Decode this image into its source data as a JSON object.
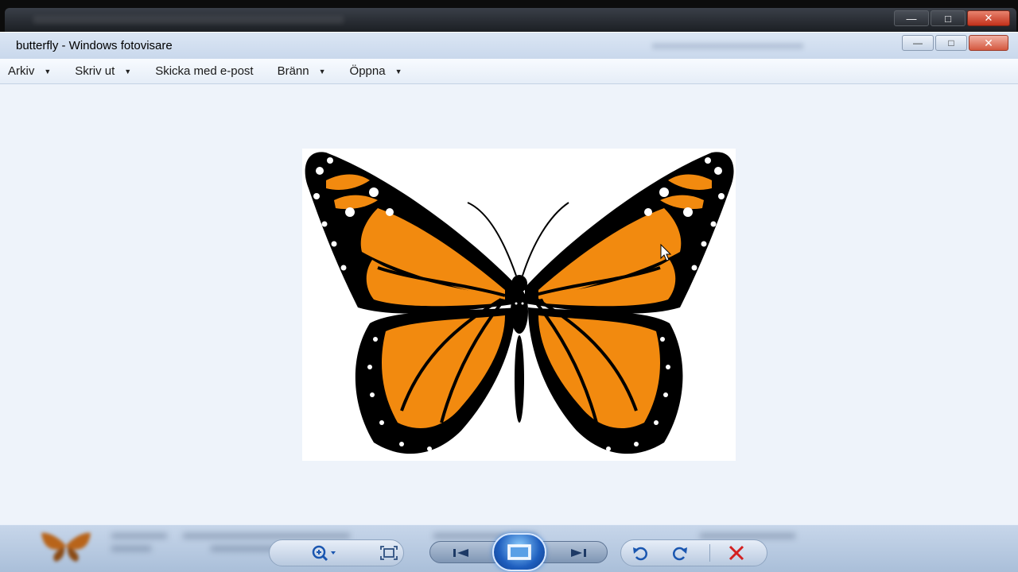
{
  "window": {
    "title": "butterfly - Windows fotovisare"
  },
  "menu": {
    "items": [
      {
        "label": "Arkiv",
        "has_dropdown": true
      },
      {
        "label": "Skriv ut",
        "has_dropdown": true
      },
      {
        "label": "Skicka med e-post",
        "has_dropdown": false
      },
      {
        "label": "Bränn",
        "has_dropdown": true
      },
      {
        "label": "Öppna",
        "has_dropdown": true
      }
    ]
  },
  "image": {
    "subject": "monarch butterfly"
  },
  "controls": {
    "icons": [
      "zoom-icon",
      "fit-window-icon",
      "previous-icon",
      "slideshow-icon",
      "next-icon",
      "rotate-counterclockwise-icon",
      "rotate-clockwise-icon",
      "delete-icon"
    ]
  },
  "colors": {
    "wing_orange": "#f28a0f",
    "wing_black": "#000000",
    "delete_red": "#d42020",
    "accent_blue": "#1f5fbf"
  }
}
